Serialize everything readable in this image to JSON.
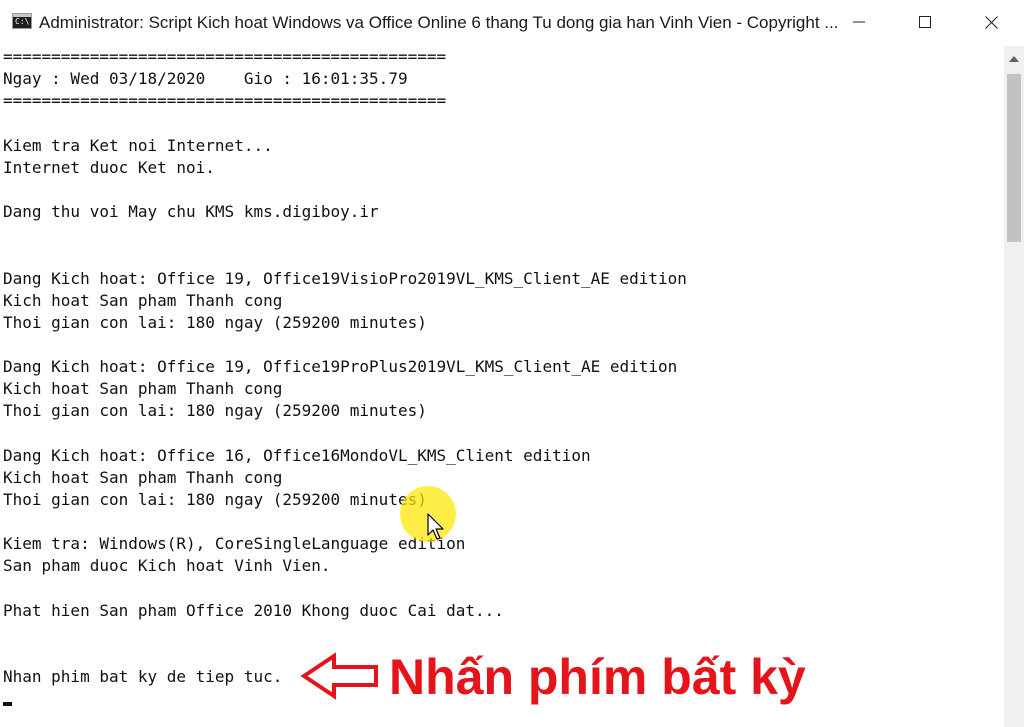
{
  "window": {
    "title": "Administrator:  Script Kich hoat Windows va Office Online 6 thang Tu dong gia han Vinh Vien - Copyright ...",
    "icon": "cmd-icon",
    "icon_glyph": "C:\\",
    "controls": [
      "minimize-icon",
      "maximize-icon",
      "close-icon"
    ]
  },
  "console_lines": [
    {
      "text": "=============================================="
    },
    {
      "text": "Ngay : Wed 03/18/2020    Gio : 16:01:35.79"
    },
    {
      "text": "=============================================="
    },
    {
      "text": ""
    },
    {
      "text": "Kiem tra Ket noi Internet..."
    },
    {
      "text": "Internet duoc Ket noi."
    },
    {
      "text": ""
    },
    {
      "text": "Dang thu voi May chu KMS kms.digiboy.ir"
    },
    {
      "text": ""
    },
    {
      "text": ""
    },
    {
      "text": "Dang Kich hoat: Office 19, Office19VisioPro2019VL_KMS_Client_AE edition"
    },
    {
      "text": "Kich hoat San pham Thanh cong"
    },
    {
      "text": "Thoi gian con lai: 180 ngay (259200 minutes)"
    },
    {
      "text": ""
    },
    {
      "text": "Dang Kich hoat: Office 19, Office19ProPlus2019VL_KMS_Client_AE edition"
    },
    {
      "text": "Kich hoat San pham Thanh cong"
    },
    {
      "text": "Thoi gian con lai: 180 ngay (259200 minutes)"
    },
    {
      "text": ""
    },
    {
      "text": "Dang Kich hoat: Office 16, Office16MondoVL_KMS_Client edition"
    },
    {
      "text": "Kich hoat San pham Thanh cong"
    },
    {
      "text": "Thoi gian con lai: 180 ngay (259200 minutes)"
    },
    {
      "text": ""
    },
    {
      "text": "Kiem tra: Windows(R), CoreSingleLanguage edition"
    },
    {
      "text": "San pham duoc Kich hoat Vinh Vien."
    },
    {
      "text": ""
    },
    {
      "text": "Phat hien San pham Office 2010 Khong duoc Cai dat..."
    },
    {
      "text": ""
    },
    {
      "text": ""
    },
    {
      "text": "Nhan phim bat ky de tiep tuc."
    }
  ],
  "annotation": {
    "text": "Nhấn phím bất kỳ",
    "color": "#e5141b",
    "arrow_icon": "left-arrow-icon"
  },
  "colors": {
    "console_bg": "#ffffff",
    "console_text": "#111111",
    "cursor_highlight": "#ffe600"
  }
}
